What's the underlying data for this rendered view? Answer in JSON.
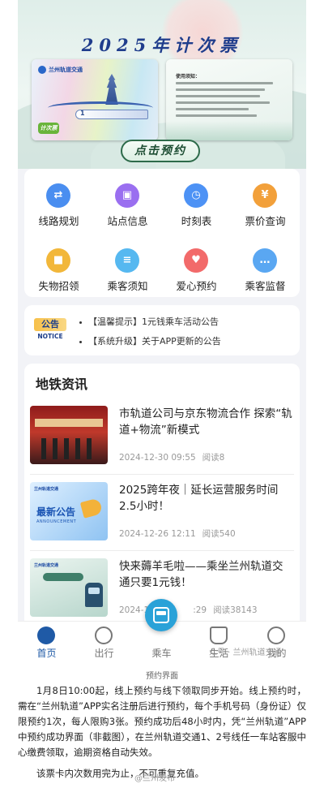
{
  "banner": {
    "title": "2025年计次票",
    "reserve_button": "点击预约",
    "card_left_logo": "兰州轨道交通",
    "card_left_tag": "计次票",
    "card_left_number": "1",
    "card_right_title": "使用须知："
  },
  "functions": [
    {
      "label": "线路规划",
      "icon": "route-icon",
      "color": "#4a8ef0"
    },
    {
      "label": "站点信息",
      "icon": "station-icon",
      "color": "#9a6ff0"
    },
    {
      "label": "时刻表",
      "icon": "clock-icon",
      "color": "#4d92f5"
    },
    {
      "label": "票价查询",
      "icon": "ticket-icon",
      "color": "#f2a03a"
    },
    {
      "label": "失物招领",
      "icon": "lost-found-icon",
      "color": "#f2b73a"
    },
    {
      "label": "乘客须知",
      "icon": "notice-icon",
      "color": "#56b8f0"
    },
    {
      "label": "爱心预约",
      "icon": "heart-icon",
      "color": "#f26a6a"
    },
    {
      "label": "乘客监督",
      "icon": "feedback-icon",
      "color": "#5aa7f2"
    }
  ],
  "notices": {
    "badge_top": "公告",
    "badge_bottom": "NOTICE",
    "items": [
      "【温馨提示】1元钱乘车活动公告",
      "【系统升级】关于APP更新的公告"
    ]
  },
  "news": {
    "section_title": "地铁资讯",
    "items": [
      {
        "title": "市轨道公司与京东物流合作 探索“轨道+物流”新模式",
        "date": "2024-12-30 09:55",
        "reads": "阅读8"
      },
      {
        "title": "2025跨年夜｜延长运营服务时间2.5小时！",
        "date": "2024-12-26 12:11",
        "reads": "阅读540"
      },
      {
        "title": "快来薅羊毛啦——乘坐兰州轨道交通只要1元钱！",
        "date": "2024-1",
        "time_fragment": ":29",
        "reads": "阅读38143"
      }
    ],
    "thumb2_big": "最新公告",
    "thumb2_sub": "ANNOUNCEMENT",
    "thumb_header": "兰州轨道交通"
  },
  "tabbar": {
    "items": [
      {
        "label": "首页",
        "icon": "home-icon",
        "active": true
      },
      {
        "label": "出行",
        "icon": "travel-icon",
        "active": false
      },
      {
        "label": "乘车",
        "icon": "ride-icon",
        "active": false
      },
      {
        "label": "生活",
        "icon": "life-icon",
        "active": false
      },
      {
        "label": "我的",
        "icon": "profile-icon",
        "active": false
      }
    ],
    "watermark": "众号 · 兰州轨道交通"
  },
  "caption": "预约界面",
  "article": {
    "p1": "1月8日10:00起，线上预约与线下领取同步开始。线上预约时，需在“兰州轨道”APP实名注册后进行预约，每个手机号码（身份证）仅限预约1次，每人限购3张。预约成功后48小时内，凭“兰州轨道”APP中预约成功界面（非截图），在兰州轨道交通1、2号线任一车站客服中心缴费领取，逾期资格自动失效。",
    "p2": "该票卡内次数用完为止，不可重复充值。"
  },
  "footer_watermark": "@兰州发布"
}
